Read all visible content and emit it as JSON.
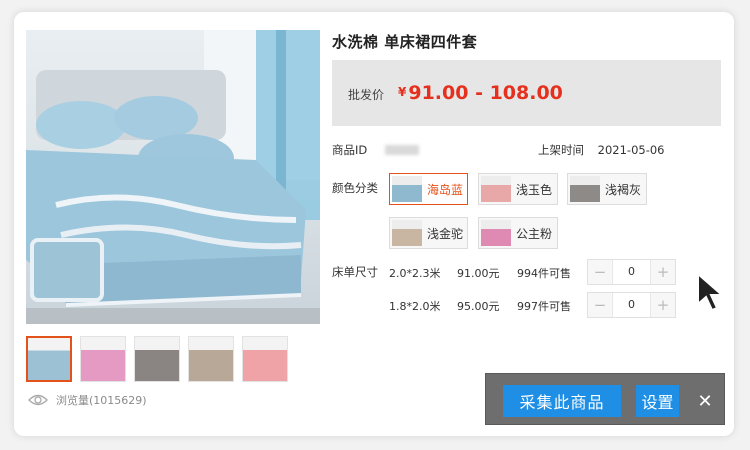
{
  "product": {
    "title": "水洗棉 单床裙四件套",
    "price_label": "批发价",
    "currency": "¥",
    "price_range": "91.00 - 108.00",
    "id_label": "商品ID",
    "listed_label": "上架时间",
    "listed_date": "2021-05-06",
    "views_text": "浏览量(1015629)"
  },
  "colors": {
    "label": "颜色分类",
    "options": [
      {
        "name": "海岛蓝",
        "swatch": "#8fb9cf",
        "selected": true
      },
      {
        "name": "浅玉色",
        "swatch": "#e9a8a8"
      },
      {
        "name": "浅褐灰",
        "swatch": "#8e8a88"
      },
      {
        "name": "浅金驼",
        "swatch": "#c9b6a2"
      },
      {
        "name": "公主粉",
        "swatch": "#df8ab3"
      }
    ]
  },
  "sizes": {
    "label": "床单尺寸",
    "rows": [
      {
        "size": "2.0*2.3米",
        "price": "91.00元",
        "stock": "994件可售",
        "qty": "0"
      },
      {
        "size": "1.8*2.0米",
        "price": "95.00元",
        "stock": "997件可售",
        "qty": "0"
      }
    ]
  },
  "thumbnails": [
    {
      "color": "#9cc0d4",
      "selected": true
    },
    {
      "color": "#e59ac4"
    },
    {
      "color": "#8a8582"
    },
    {
      "color": "#b7a898"
    },
    {
      "color": "#efa3a6"
    }
  ],
  "toolbar": {
    "collect_label": "采集此商品",
    "settings_label": "设置",
    "close_label": "✕"
  }
}
